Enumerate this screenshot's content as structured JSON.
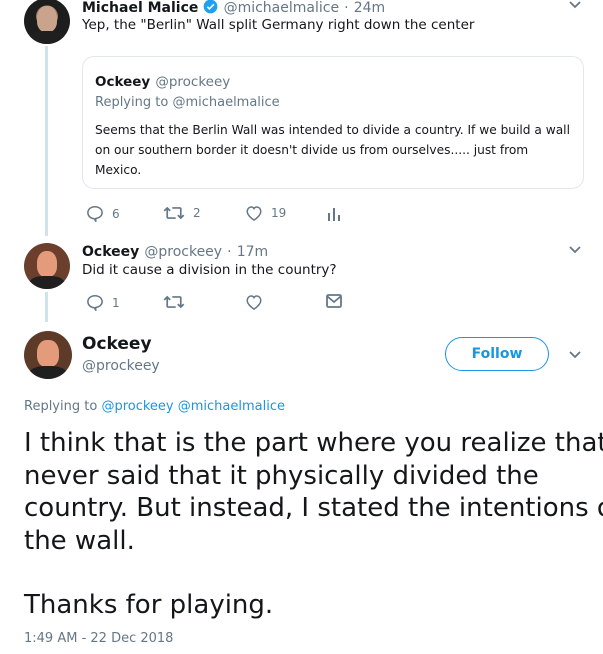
{
  "tweet1": {
    "name": "Michael Malice",
    "handle": "@michaelmalice",
    "time": "24m",
    "text": "Yep, the \"Berlin\" Wall split Germany right down the center",
    "quote": {
      "name": "Ockeey",
      "handle": "@prockeey",
      "replying_prefix": "Replying to",
      "replying_to": "@michaelmalice",
      "text_line1": "Seems that the Berlin Wall was intended to divide a country. If we build a wall",
      "text_line2": "on our southern border it doesn't divide us from ourselves..... just from",
      "text_line3": "Mexico."
    },
    "actions": {
      "replies": "6",
      "retweets": "2",
      "likes": "19"
    }
  },
  "tweet2": {
    "name": "Ockeey",
    "handle": "@prockeey",
    "time": "17m",
    "text": "Did it cause a division in the country?",
    "actions": {
      "replies": "1"
    }
  },
  "main_tweet": {
    "name": "Ockeey",
    "handle": "@prockeey",
    "follow_label": "Follow",
    "replying_prefix": "Replying to",
    "replying_to_1": "@prockeey",
    "replying_to_2": "@michaelmalice",
    "line1": "I think that is the part where you realize that I",
    "line2": "never said that it physically divided the",
    "line3": "country. But instead, I stated the intentions of",
    "line4": "the wall.",
    "line5": "Thanks for playing.",
    "timestamp": "1:49 AM - 22 Dec 2018"
  },
  "colors": {
    "accent": "#1b95e0",
    "secondary_text": "#657786",
    "thread_line": "#cfe3ef",
    "verified": "#1da1f2"
  }
}
